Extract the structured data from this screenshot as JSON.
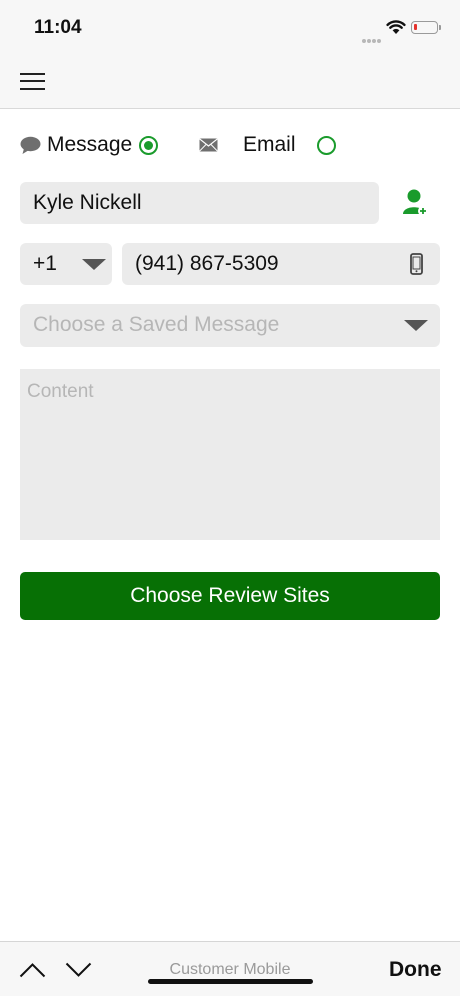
{
  "status_bar": {
    "time": "11:04",
    "battery_color": "#e5322d"
  },
  "nav": {
    "menu_icon": "hamburger-menu-icon"
  },
  "mode": {
    "message_label": "Message",
    "email_label": "Email",
    "selected": "Message",
    "accent_color": "#1a9b2c"
  },
  "form": {
    "name_value": "Kyle Nickell",
    "country_code": "+1",
    "phone_value": "(941) 867-5309",
    "saved_message_placeholder": "Choose a Saved Message",
    "content_placeholder": "Content",
    "content_value": ""
  },
  "actions": {
    "choose_review_sites_label": "Choose Review Sites",
    "button_color": "#077005"
  },
  "keyboard_toolbar": {
    "field_name": "Customer Mobile",
    "done_label": "Done"
  }
}
